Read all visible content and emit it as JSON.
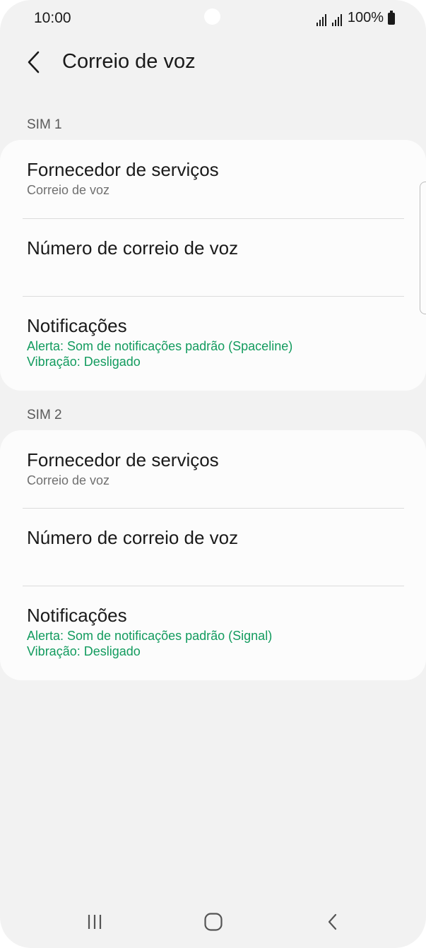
{
  "status_bar": {
    "time": "10:00",
    "battery": "100%"
  },
  "header": {
    "title": "Correio de voz",
    "back_icon": "chevron-left-icon"
  },
  "sim1": {
    "label": "SIM 1",
    "provider": {
      "title": "Fornecedor de serviços",
      "subtitle": "Correio de voz"
    },
    "number": {
      "title": "Número de correio de voz"
    },
    "notifications": {
      "title": "Notificações",
      "alert": "Alerta: Som de notificações padrão (Spaceline)",
      "vibration": "Vibração: Desligado"
    }
  },
  "sim2": {
    "label": "SIM 2",
    "provider": {
      "title": "Fornecedor de serviços",
      "subtitle": "Correio de voz"
    },
    "number": {
      "title": "Número de correio de voz"
    },
    "notifications": {
      "title": "Notificações",
      "alert": "Alerta: Som de notificações padrão (Signal)",
      "vibration": "Vibração: Desligado"
    }
  },
  "nav": {
    "recents_icon": "recents-icon",
    "home_icon": "home-icon",
    "back_icon": "back-icon"
  },
  "colors": {
    "accent_green": "#129b5e",
    "background": "#f2f2f2",
    "card": "#fcfcfc"
  }
}
